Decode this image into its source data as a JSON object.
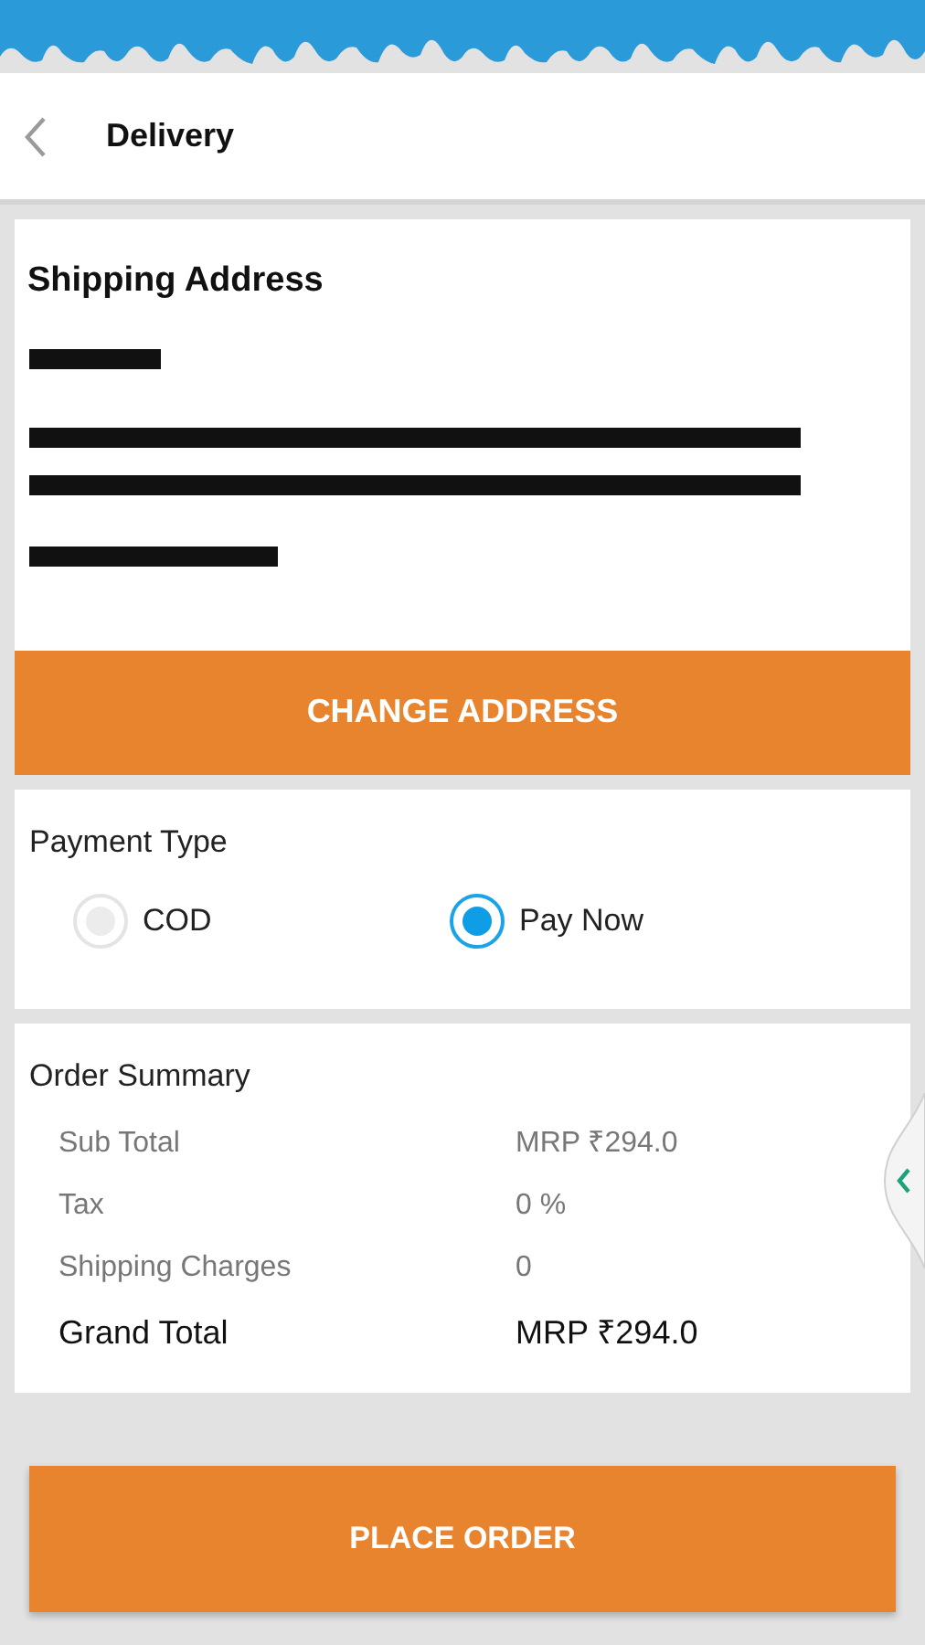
{
  "header": {
    "title": "Delivery"
  },
  "shipping": {
    "title": "Shipping Address",
    "redactions": [
      {
        "kind": "short"
      },
      {
        "kind": "long"
      },
      {
        "kind": "long"
      },
      {
        "kind": "medium"
      }
    ],
    "button": "CHANGE ADDRESS"
  },
  "payment": {
    "title": "Payment Type",
    "options": [
      {
        "label": "COD",
        "selected": false
      },
      {
        "label": "Pay Now",
        "selected": true
      }
    ]
  },
  "summary": {
    "title": "Order Summary",
    "rows": [
      {
        "label": "Sub Total",
        "value": "MRP ₹294.0",
        "kind": "line"
      },
      {
        "label": "Tax",
        "value": "0 %",
        "kind": "line"
      },
      {
        "label": "Shipping Charges",
        "value": "0",
        "kind": "line"
      },
      {
        "label": "Grand Total",
        "value": "MRP ₹294.0",
        "kind": "total"
      }
    ]
  },
  "place_order": "PLACE ORDER"
}
